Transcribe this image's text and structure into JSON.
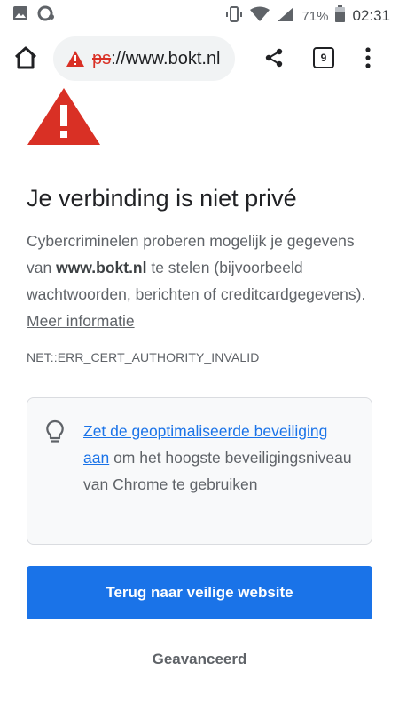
{
  "status_bar": {
    "battery_percent": "71%",
    "time": "02:31",
    "icons": [
      "image-icon",
      "sync-icon",
      "vibrate-icon",
      "wifi-icon",
      "signal-icon",
      "battery-icon"
    ]
  },
  "toolbar": {
    "url_scheme": "ps",
    "url_rest": "://www.bokt.nl",
    "tab_count": "9",
    "icons": [
      "home-icon",
      "warning-icon",
      "share-icon",
      "tabs-icon",
      "more-vert-icon"
    ]
  },
  "interstitial": {
    "heading": "Je verbinding is niet privé",
    "explanation_part1": "Cybercriminelen proberen mogelijk je gegevens van ",
    "site": "www.bokt.nl",
    "explanation_part2": " te stelen (bijvoorbeeld wachtwoorden, berichten of creditcardgegevens). ",
    "learn_more": "Meer informatie",
    "error_code": "NET::ERR_CERT_AUTHORITY_INVALID",
    "promo_link": "Zet de geoptimaliseerde beveiliging aan",
    "promo_text": " om het hoogste beveiligingsniveau van Chrome te gebruiken",
    "primary_button": "Terug naar veilige website",
    "secondary_button": "Geavanceerd"
  },
  "colors": {
    "warning_red": "#d93025",
    "primary_blue": "#1a73e8",
    "link_blue": "#1a73e8",
    "text_secondary": "#5f6368"
  }
}
